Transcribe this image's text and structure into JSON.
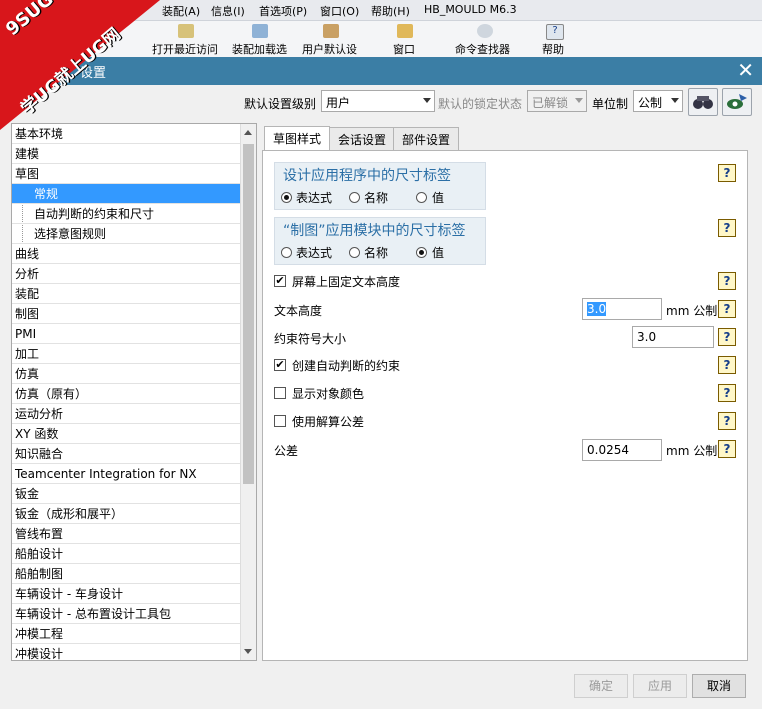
{
  "menu": [
    "装配(A)",
    "信息(I)",
    "首选项(P)",
    "窗口(O)",
    "帮助(H)",
    "HB_MOULD M6.3"
  ],
  "toolbar": [
    "打开最近访问",
    "装配加载选",
    "用户默认设",
    "窗口",
    "命令查找器",
    "帮助"
  ],
  "dialog": {
    "title": "设置",
    "close": "✕"
  },
  "badge": {
    "line1": "9SUG",
    "line2": "学UG就上UG网"
  },
  "settings": {
    "level_label": "默认设置级别",
    "level_value": "用户",
    "lock_label": "默认的锁定状态",
    "lock_value": "已解锁",
    "unit_label": "单位制",
    "unit_value": "公制"
  },
  "tree": [
    {
      "label": "基本环境",
      "indent": false
    },
    {
      "label": "建模",
      "indent": false
    },
    {
      "label": "草图",
      "indent": false
    },
    {
      "label": "常规",
      "indent": true,
      "selected": true
    },
    {
      "label": "自动判断的约束和尺寸",
      "indent": true
    },
    {
      "label": "选择意图规则",
      "indent": true
    },
    {
      "label": "曲线",
      "indent": false
    },
    {
      "label": "分析",
      "indent": false
    },
    {
      "label": "装配",
      "indent": false
    },
    {
      "label": "制图",
      "indent": false
    },
    {
      "label": "PMI",
      "indent": false
    },
    {
      "label": "加工",
      "indent": false
    },
    {
      "label": "仿真",
      "indent": false
    },
    {
      "label": "仿真（原有）",
      "indent": false
    },
    {
      "label": "运动分析",
      "indent": false
    },
    {
      "label": "XY 函数",
      "indent": false
    },
    {
      "label": "知识融合",
      "indent": false
    },
    {
      "label": "Teamcenter Integration for NX",
      "indent": false
    },
    {
      "label": "钣金",
      "indent": false
    },
    {
      "label": "钣金（成形和展平）",
      "indent": false
    },
    {
      "label": "管线布置",
      "indent": false
    },
    {
      "label": "船舶设计",
      "indent": false
    },
    {
      "label": "船舶制图",
      "indent": false
    },
    {
      "label": "车辆设计 - 车身设计",
      "indent": false
    },
    {
      "label": "车辆设计 - 总布置设计工具包",
      "indent": false
    },
    {
      "label": "冲模工程",
      "indent": false
    },
    {
      "label": "冲模设计",
      "indent": false
    }
  ],
  "tabs": [
    "草图样式",
    "会话设置",
    "部件设置"
  ],
  "panel": {
    "group1_title": "设计应用程序中的尺寸标签",
    "group2_title": "“制图”应用模块中的尺寸标签",
    "opt_expr": "表达式",
    "opt_name": "名称",
    "opt_value": "值",
    "fixed_text": "屏幕上固定文本高度",
    "text_height_label": "文本高度",
    "text_height_value": "3.0",
    "unit_mm": "mm 公制",
    "constraint_size_label": "约束符号大小",
    "constraint_size_value": "3.0",
    "create_auto": "创建自动判断的约束",
    "show_color": "显示对象颜色",
    "use_tolerance": "使用解算公差",
    "tolerance_label": "公差",
    "tolerance_value": "0.0254",
    "help": "?"
  },
  "buttons": {
    "ok": "确定",
    "apply": "应用",
    "cancel": "取消"
  }
}
